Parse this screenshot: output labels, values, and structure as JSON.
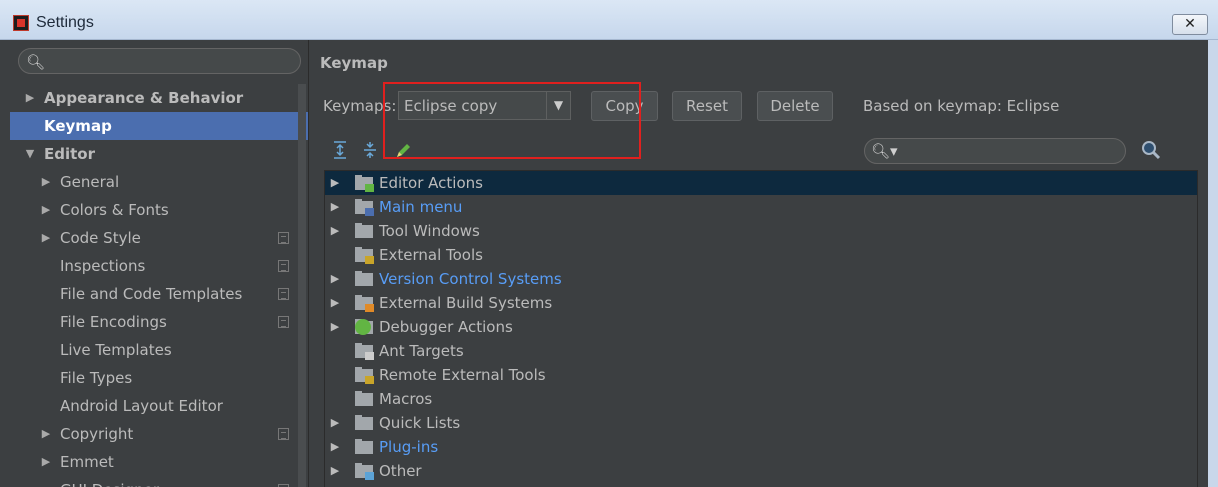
{
  "window": {
    "title": "Settings",
    "close_label": "✕"
  },
  "sidebar": {
    "search_placeholder": "",
    "items": [
      {
        "label": "Appearance & Behavior",
        "level": 0,
        "expandable": true,
        "expanded": false,
        "bold": true
      },
      {
        "label": "Keymap",
        "level": 0,
        "expandable": false,
        "bold": true,
        "selected": true
      },
      {
        "label": "Editor",
        "level": 0,
        "expandable": true,
        "expanded": true,
        "bold": true
      },
      {
        "label": "General",
        "level": 1,
        "expandable": true
      },
      {
        "label": "Colors & Fonts",
        "level": 1,
        "expandable": true
      },
      {
        "label": "Code Style",
        "level": 1,
        "expandable": true,
        "project_icon": true
      },
      {
        "label": "Inspections",
        "level": 1,
        "project_icon": true
      },
      {
        "label": "File and Code Templates",
        "level": 1,
        "project_icon": true
      },
      {
        "label": "File Encodings",
        "level": 1,
        "project_icon": true
      },
      {
        "label": "Live Templates",
        "level": 1
      },
      {
        "label": "File Types",
        "level": 1
      },
      {
        "label": "Android Layout Editor",
        "level": 1
      },
      {
        "label": "Copyright",
        "level": 1,
        "expandable": true,
        "project_icon": true
      },
      {
        "label": "Emmet",
        "level": 1,
        "expandable": true
      },
      {
        "label": "GUI Designer",
        "level": 1,
        "project_icon": true
      }
    ]
  },
  "main": {
    "title": "Keymap",
    "keymaps_label": "Keymaps:",
    "keymap_selected": "Eclipse copy",
    "buttons": {
      "copy": "Copy",
      "reset": "Reset",
      "delete": "Delete"
    },
    "based_on": "Based on keymap: Eclipse",
    "filter_placeholder": ""
  },
  "actions": [
    {
      "label": "Editor Actions",
      "expandable": true,
      "selected": true,
      "badge": "pencil",
      "link": false
    },
    {
      "label": "Main menu",
      "expandable": true,
      "badge": "menu",
      "link": true
    },
    {
      "label": "Tool Windows",
      "expandable": true,
      "link": false
    },
    {
      "label": "External Tools",
      "expandable": false,
      "badge": "tools",
      "link": false
    },
    {
      "label": "Version Control Systems",
      "expandable": true,
      "link": true
    },
    {
      "label": "External Build Systems",
      "expandable": true,
      "badge": "build",
      "link": false
    },
    {
      "label": "Debugger Actions",
      "expandable": true,
      "badge": "bug",
      "link": false
    },
    {
      "label": "Ant Targets",
      "expandable": false,
      "badge": "ant",
      "link": false
    },
    {
      "label": "Remote External Tools",
      "expandable": false,
      "badge": "tools",
      "link": false
    },
    {
      "label": "Macros",
      "expandable": false,
      "link": false
    },
    {
      "label": "Quick Lists",
      "expandable": true,
      "link": false
    },
    {
      "label": "Plug-ins",
      "expandable": true,
      "link": true
    },
    {
      "label": "Other",
      "expandable": true,
      "badge": "other",
      "link": false
    }
  ],
  "colors": {
    "selection": "#4b6eaf",
    "tree_selection": "#0d293e",
    "link": "#589df6",
    "highlight": "#e0201e"
  }
}
